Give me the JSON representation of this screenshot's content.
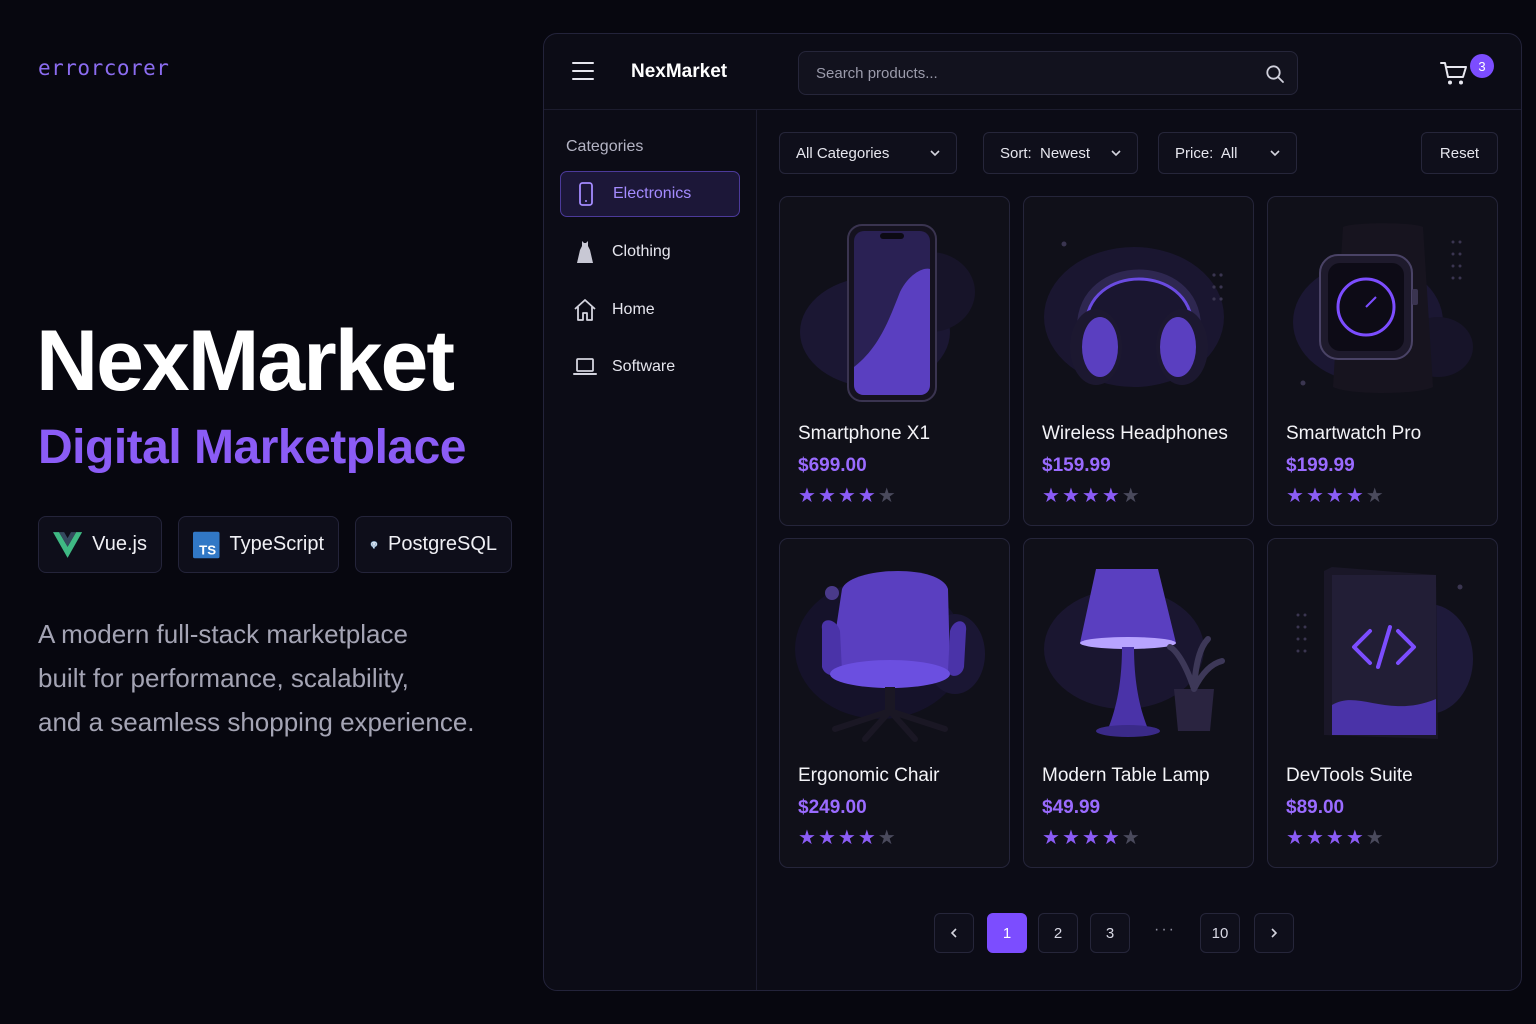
{
  "brand": "errorcorer",
  "hero": {
    "title": "NexMarket",
    "subtitle": "Digital Marketplace",
    "tech": [
      {
        "label": "Vue.js",
        "icon": "vue-icon"
      },
      {
        "label": "TypeScript",
        "icon": "typescript-icon"
      },
      {
        "label": "PostgreSQL",
        "icon": "postgresql-icon"
      }
    ],
    "description": [
      "A modern full-stack marketplace",
      "built for performance, scalability,",
      "and a seamless shopping experience."
    ]
  },
  "app": {
    "title": "NexMarket",
    "search_placeholder": "Search products...",
    "cart_count": "3",
    "sidebar": {
      "title": "Categories",
      "items": [
        {
          "label": "Electronics",
          "icon": "smartphone-icon",
          "active": true
        },
        {
          "label": "Clothing",
          "icon": "dress-icon",
          "active": false
        },
        {
          "label": "Home",
          "icon": "house-icon",
          "active": false
        },
        {
          "label": "Software",
          "icon": "laptop-icon",
          "active": false
        }
      ]
    },
    "filters": {
      "category": "All Categories",
      "sort": "Sort:  Newest",
      "price": "Price:  All",
      "reset": "Reset"
    },
    "products": [
      {
        "name": "Smartphone X1",
        "price": "$699.00",
        "rating": 4
      },
      {
        "name": "Wireless Headphones",
        "price": "$159.99",
        "rating": 4
      },
      {
        "name": "Smartwatch Pro",
        "price": "$199.99",
        "rating": 4
      },
      {
        "name": "Ergonomic Chair",
        "price": "$249.00",
        "rating": 4
      },
      {
        "name": "Modern Table Lamp",
        "price": "$49.99",
        "rating": 4
      },
      {
        "name": "DevTools Suite",
        "price": "$89.00",
        "rating": 4
      }
    ],
    "pagination": {
      "pages": [
        "1",
        "2",
        "3",
        "10"
      ],
      "ellipsis": "···",
      "current": "1"
    }
  },
  "colors": {
    "accent": "#8b5cf6",
    "badge": "#7c4dff",
    "background": "#07070f",
    "panel": "#0c0c16"
  }
}
